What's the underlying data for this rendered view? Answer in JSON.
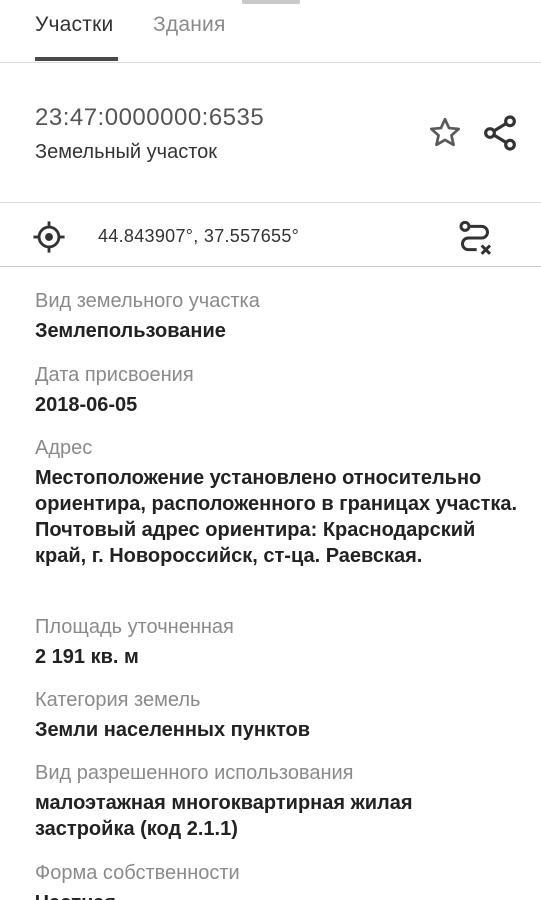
{
  "tabs": [
    {
      "label": "Участки",
      "active": true
    },
    {
      "label": "Здания",
      "active": false
    }
  ],
  "header": {
    "cadastral_number": "23:47:0000000:6535",
    "object_type": "Земельный участок",
    "icons": {
      "favorite": "star-outline-icon",
      "share": "share-icon"
    }
  },
  "coords": {
    "text": "44.843907°, 37.557655°",
    "icons": {
      "locate": "crosshair-icon",
      "route": "route-clear-icon"
    }
  },
  "fields": [
    {
      "label": "Вид земельного участка",
      "value": "Землепользование"
    },
    {
      "label": "Дата присвоения",
      "value": "2018-06-05"
    },
    {
      "label": "Адрес",
      "value": "Местоположение установлено относительно ориентира, расположенного в границах участка. Почтовый адрес ориентира: Краснодарский край, г. Новороссийск, ст-ца. Раевская."
    },
    {
      "label": "Площадь уточненная",
      "value": "2 191 кв. м"
    },
    {
      "label": "Категория земель",
      "value": "Земли населенных пунктов"
    },
    {
      "label": "Вид разрешенного использования",
      "value": "малоэтажная многоквартирная жилая застройка (код 2.1.1)"
    },
    {
      "label": "Форма собственности",
      "value": "Частная"
    }
  ],
  "colors": {
    "accent": "#4a4a4a",
    "label": "#8a8a8a",
    "value": "#222222",
    "divider": "#dcdcdc"
  }
}
